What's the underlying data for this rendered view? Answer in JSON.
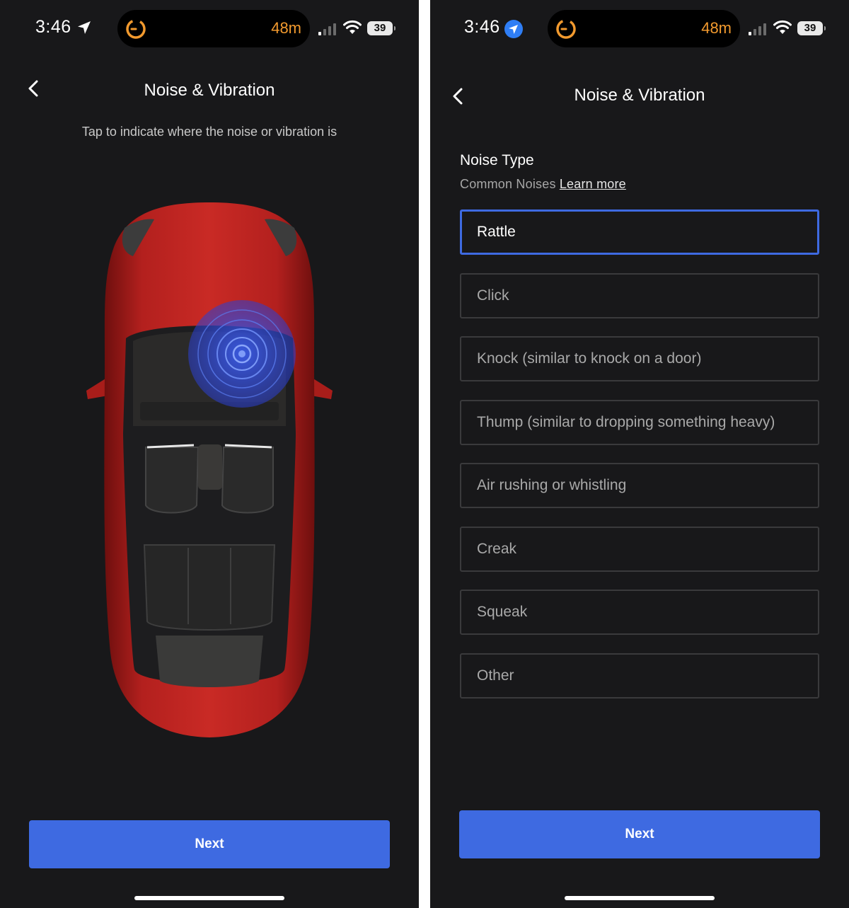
{
  "status_bar": {
    "time": "3:46",
    "timer": "48m",
    "battery": "39"
  },
  "screen_left": {
    "title": "Noise & Vibration",
    "instruction": "Tap to indicate where the noise or vibration is",
    "next_label": "Next"
  },
  "screen_right": {
    "title": "Noise & Vibration",
    "section_title": "Noise Type",
    "section_subtitle": "Common Noises",
    "learn_more": "Learn more",
    "options": [
      {
        "label": "Rattle",
        "selected": true
      },
      {
        "label": "Click",
        "selected": false
      },
      {
        "label": "Knock (similar to knock on a door)",
        "selected": false
      },
      {
        "label": "Thump (similar to dropping something heavy)",
        "selected": false
      },
      {
        "label": "Air rushing or whistling",
        "selected": false
      },
      {
        "label": "Creak",
        "selected": false
      },
      {
        "label": "Squeak",
        "selected": false
      },
      {
        "label": "Other",
        "selected": false
      }
    ],
    "next_label": "Next"
  },
  "colors": {
    "background": "#18181a",
    "accent": "#3e6ae1",
    "car_red": "#b3201e",
    "timer_orange": "#f29a2e"
  }
}
